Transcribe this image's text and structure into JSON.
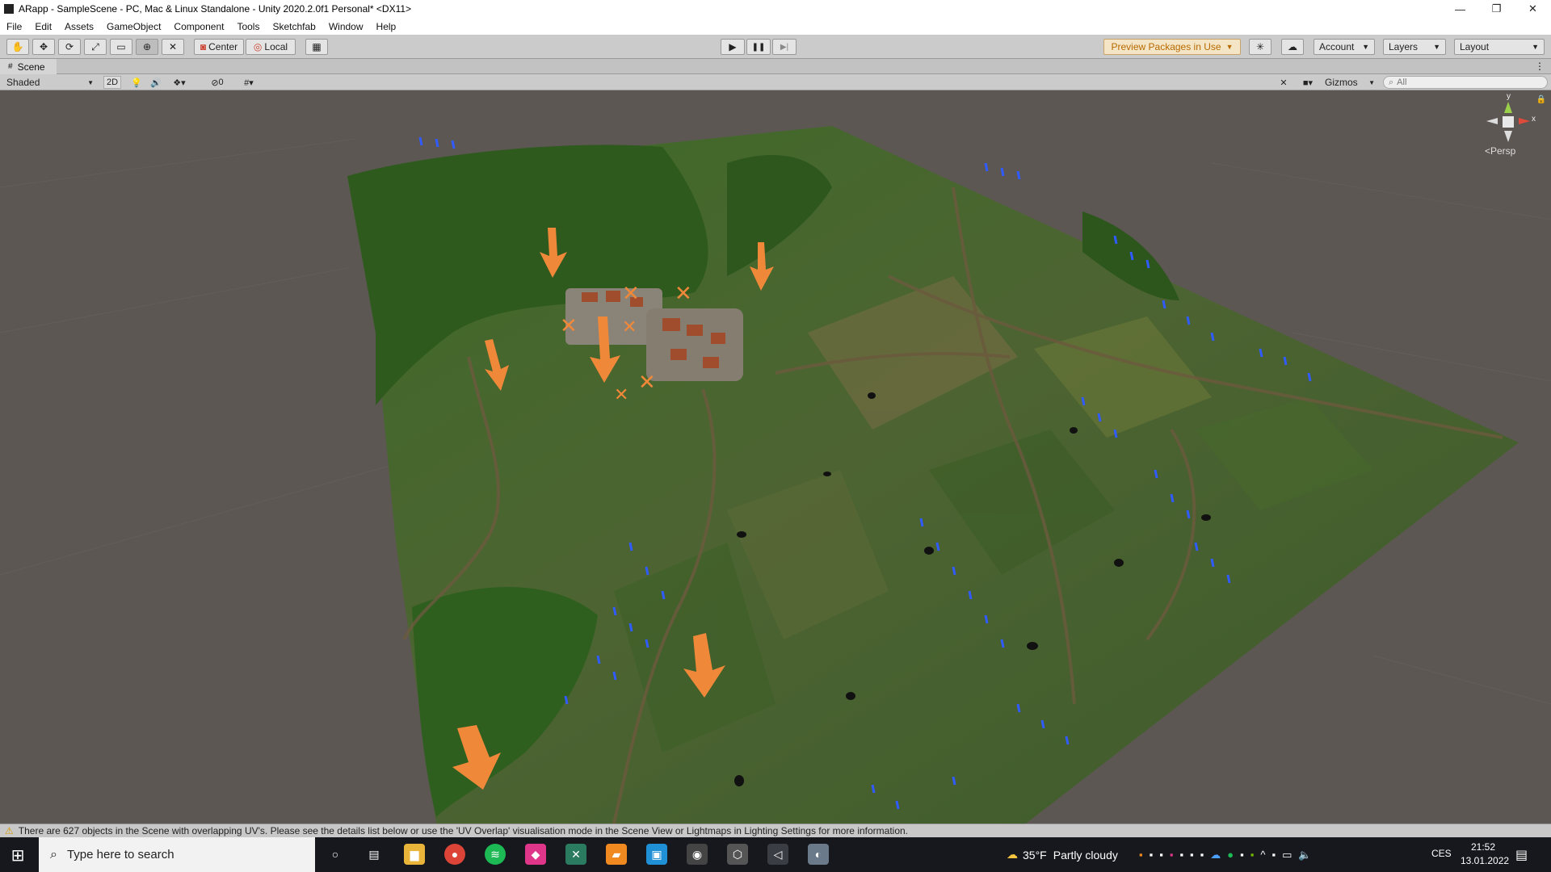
{
  "window": {
    "title": "ARapp - SampleScene - PC, Mac & Linux Standalone - Unity 2020.2.0f1 Personal* <DX11>",
    "minimize": "—",
    "restore": "❐",
    "close": "✕"
  },
  "menu": [
    "File",
    "Edit",
    "Assets",
    "GameObject",
    "Component",
    "Tools",
    "Sketchfab",
    "Window",
    "Help"
  ],
  "toolbar": {
    "tool_icons": [
      "hand-icon",
      "move-icon",
      "rotate-icon",
      "scale-icon",
      "rect-icon",
      "transform-icon",
      "custom-tool-icon"
    ],
    "pivot_label": "Center",
    "space_label": "Local",
    "play_icon": "▶",
    "pause_icon": "❚❚",
    "step_icon": "▶|",
    "preview_packages": "Preview Packages in Use",
    "account": "Account",
    "layers": "Layers",
    "layout": "Layout"
  },
  "scene_tab": {
    "label": "Scene"
  },
  "scene_tools": {
    "shading_mode": "Shaded",
    "toggle_2d": "2D",
    "hidden_count": "0",
    "gizmos": "Gizmos",
    "search_placeholder": "All",
    "view_mode": "<Persp"
  },
  "gizmo_axes": {
    "y": "y",
    "x": "x"
  },
  "status": {
    "message": "There are 627 objects in the Scene with overlapping UV's. Please see the details list below or use the 'UV Overlap' visualisation mode in the Scene View or Lightmaps in Lighting Settings for more information."
  },
  "taskbar": {
    "search_placeholder": "Type here to search",
    "weather_temp": "35°F",
    "weather_desc": "Partly cloudy",
    "language": "CES",
    "time": "21:52",
    "date": "13.01.2022"
  },
  "colors": {
    "accent_orange": "#f0883a",
    "scene_background": "#5d5754",
    "terrain_green": "#4a6b2e",
    "marker_blue": "#2f5bff",
    "taskbar": "#16181d"
  }
}
